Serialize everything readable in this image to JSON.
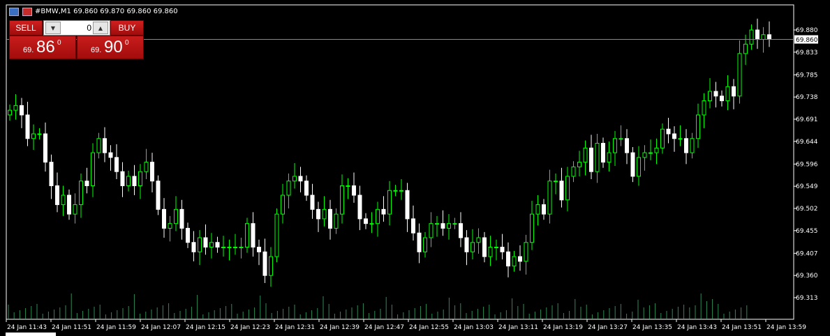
{
  "header": {
    "title": "#BMW,M1  69.860 69.870 69.860 69.860"
  },
  "trade_panel": {
    "sell_label": "SELL",
    "buy_label": "BUY",
    "lot_value": "0",
    "sell_price_prefix": "69.",
    "sell_price_main": "86",
    "sell_price_sup": "0",
    "buy_price_prefix": "69.",
    "buy_price_main": "90",
    "buy_price_sup": "0"
  },
  "colors": {
    "background": "#000000",
    "bull_candle": "#00ff00",
    "bear_candle": "#ffffff",
    "axis": "#ffffff",
    "volume": "#2e8b57",
    "bid_line": "#888888",
    "panel_red": "#c81c1c"
  },
  "chart_data": {
    "type": "candlestick",
    "symbol": "#BMW",
    "timeframe": "M1",
    "ylim": [
      69.3,
      69.905
    ],
    "y_ticks": [
      "69.880",
      "69.833",
      "69.785",
      "69.738",
      "69.691",
      "69.644",
      "69.596",
      "69.549",
      "69.502",
      "69.455",
      "69.407",
      "69.360",
      "69.313"
    ],
    "current_price_label": "69.860",
    "current_price": 69.86,
    "x_ticks": [
      "24 Jan 11:43",
      "24 Jan 11:51",
      "24 Jan 11:59",
      "24 Jan 12:07",
      "24 Jan 12:15",
      "24 Jan 12:23",
      "24 Jan 12:31",
      "24 Jan 12:39",
      "24 Jan 12:47",
      "24 Jan 12:55",
      "24 Jan 13:03",
      "24 Jan 13:11",
      "24 Jan 13:19",
      "24 Jan 13:27",
      "24 Jan 13:35",
      "24 Jan 13:43",
      "24 Jan 13:51",
      "24 Jan 13:59"
    ],
    "closes": [
      69.71,
      69.72,
      69.7,
      69.65,
      69.66,
      69.66,
      69.6,
      69.55,
      69.51,
      69.53,
      69.49,
      69.51,
      69.56,
      69.55,
      69.62,
      69.65,
      69.62,
      69.61,
      69.58,
      69.55,
      69.57,
      69.55,
      69.58,
      69.6,
      69.56,
      69.5,
      69.46,
      69.47,
      69.5,
      69.46,
      69.43,
      69.41,
      69.44,
      69.42,
      69.43,
      69.42,
      69.42,
      69.42,
      69.42,
      69.42,
      69.47,
      69.42,
      69.41,
      69.36,
      69.4,
      69.49,
      69.53,
      69.56,
      69.57,
      69.56,
      69.53,
      69.5,
      69.48,
      69.5,
      69.46,
      69.49,
      69.55,
      69.55,
      69.53,
      69.48,
      69.47,
      69.47,
      69.5,
      69.49,
      69.54,
      69.54,
      69.54,
      69.48,
      69.45,
      69.41,
      69.44,
      69.47,
      69.47,
      69.46,
      69.47,
      69.47,
      69.44,
      69.41,
      69.43,
      69.44,
      69.4,
      69.42,
      69.42,
      69.41,
      69.38,
      69.4,
      69.39,
      69.43,
      69.49,
      69.51,
      69.49,
      69.56,
      69.56,
      69.52,
      69.57,
      69.59,
      69.6,
      69.63,
      69.58,
      69.64,
      69.6,
      69.62,
      69.65,
      69.65,
      69.62,
      69.57,
      69.61,
      69.62,
      69.62,
      69.63,
      69.67,
      69.66,
      69.65,
      69.65,
      69.62,
      69.65,
      69.7,
      69.73,
      69.75,
      69.74,
      69.73,
      69.76,
      69.74,
      69.83,
      69.85,
      69.88,
      69.86,
      69.87,
      69.86
    ],
    "volume_bars": 130
  }
}
